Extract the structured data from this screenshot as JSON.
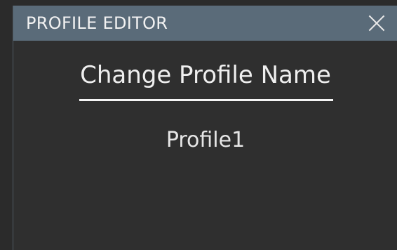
{
  "dialog": {
    "title": "PROFILE EDITOR",
    "close_icon": "close-icon",
    "heading": "Change Profile Name",
    "profile_name": "Profile1"
  },
  "colors": {
    "titlebar": "#5a6b79",
    "background": "#2f2f2f",
    "text": "#efefef"
  }
}
